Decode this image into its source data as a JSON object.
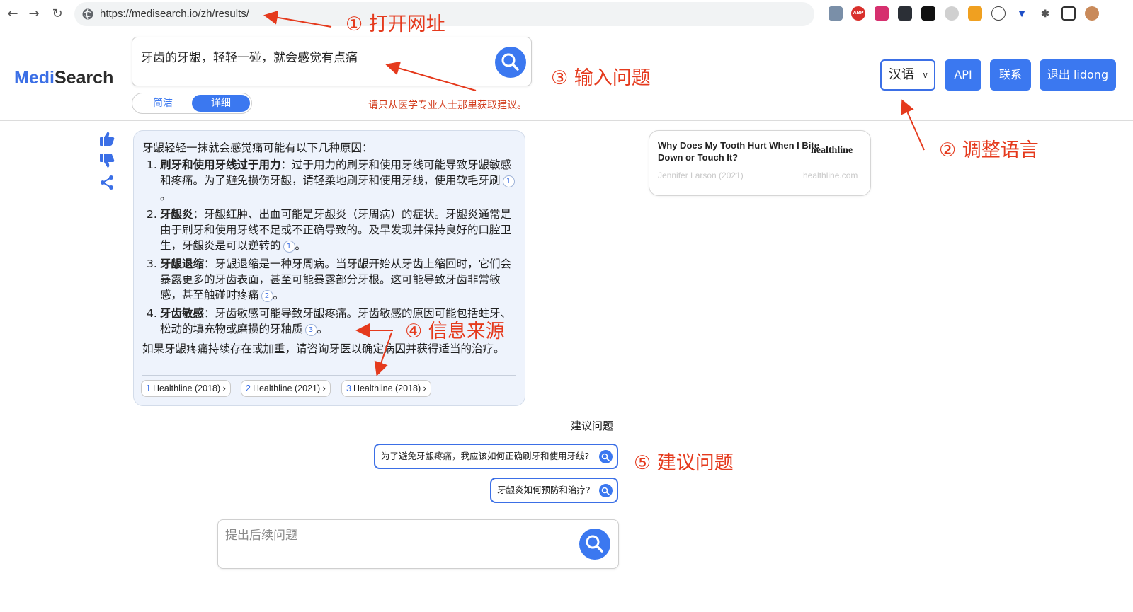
{
  "browser": {
    "url": "https://medisearch.io/zh/results/",
    "back_glyph": "←",
    "forward_glyph": "→",
    "reload_glyph": "↻",
    "extensions": [
      "image-icon",
      "abp-icon",
      "translate-icon",
      "dots-icon",
      "l-icon",
      "moon-icon",
      "puzzle-color-icon",
      "openai-icon",
      "v-icon",
      "puzzle-icon",
      "sidebar-icon",
      "avatar-icon"
    ]
  },
  "header": {
    "logo_medi": "Medi",
    "logo_search": "Search",
    "query": "牙齿的牙龈，轻轻一碰，就会感觉有点痛",
    "mode_concise": "简洁",
    "mode_detailed": "详细",
    "disclaimer": "请只从医学专业人士那里获取建议。",
    "language": "汉语",
    "api_label": "API",
    "contact_label": "联系",
    "logout_label": "退出 lidong"
  },
  "answer": {
    "intro": "牙龈轻轻一抹就会感觉痛可能有以下几种原因：",
    "items": [
      {
        "num": "1.",
        "title": "刷牙和使用牙线过于用力",
        "sep": "：",
        "text": "过于用力的刷牙和使用牙线可能导致牙龈敏感和疼痛。为了避免损伤牙龈，请轻柔地刷牙和使用牙线，使用软毛牙刷",
        "cite": "1",
        "end": "。"
      },
      {
        "num": "2.",
        "title": "牙龈炎",
        "sep": "：",
        "text": "牙龈红肿、出血可能是牙龈炎（牙周病）的症状。牙龈炎通常是由于刷牙和使用牙线不足或不正确导致的。及早发现并保持良好的口腔卫生，牙龈炎是可以逆转的",
        "cite": "1",
        "end": "。"
      },
      {
        "num": "3.",
        "title": "牙龈退缩",
        "sep": "：",
        "text": "牙龈退缩是一种牙周病。当牙龈开始从牙齿上缩回时，它们会暴露更多的牙齿表面，甚至可能暴露部分牙根。这可能导致牙齿非常敏感，甚至触碰时疼痛",
        "cite": "2",
        "end": "。"
      },
      {
        "num": "4.",
        "title": "牙齿敏感",
        "sep": "：",
        "text": "牙齿敏感可能导致牙龈疼痛。牙齿敏感的原因可能包括蛀牙、松动的填充物或磨损的牙釉质",
        "cite": "3",
        "end": "。"
      }
    ],
    "outro": "如果牙龈疼痛持续存在或加重，请咨询牙医以确定病因并获得适当的治疗。",
    "sources": [
      {
        "num": "1",
        "label": "Healthline (2018)",
        "chev": "›"
      },
      {
        "num": "2",
        "label": "Healthline (2021)",
        "chev": "›"
      },
      {
        "num": "3",
        "label": "Healthline (2018)",
        "chev": "›"
      }
    ]
  },
  "source_card": {
    "title": "Why Does My Tooth Hurt When I Bite Down or Touch It?",
    "brand": "healthline",
    "author": "Jennifer Larson (2021)",
    "domain": "healthline.com"
  },
  "suggested": {
    "heading": "建议问题",
    "questions": [
      "为了避免牙龈疼痛，我应该如何正确刷牙和使用牙线?",
      "牙龈炎如何预防和治疗?"
    ]
  },
  "followup": {
    "placeholder": "提出后续问题"
  },
  "annotations": {
    "step1": "① 打开网址",
    "step2": "② 调整语言",
    "step3": "③ 输入问题",
    "step4": "④ 信息来源",
    "step5": "⑤ 建议问题"
  },
  "colors": {
    "accent": "#3b78f0",
    "annotation": "#e53a1d",
    "answer_bg": "#eef3fc"
  }
}
